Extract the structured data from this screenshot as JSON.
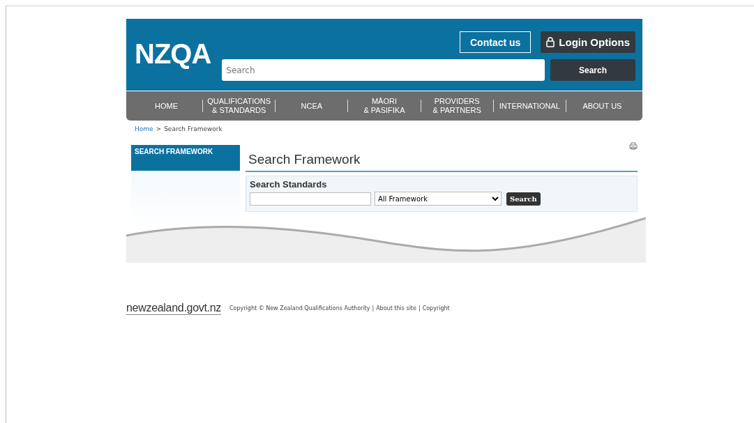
{
  "header": {
    "logo": "NZQA",
    "contact_button": "Contact us",
    "login_button": "Login Options",
    "search": {
      "placeholder": "Search"
    },
    "search_button": "Search"
  },
  "nav": [
    {
      "lines": [
        "HOME"
      ]
    },
    {
      "lines": [
        "QUALIFICATIONS",
        "& STANDARDS"
      ]
    },
    {
      "lines": [
        "NCEA"
      ]
    },
    {
      "lines": [
        "MĀORI",
        "& PASIFIKA"
      ]
    },
    {
      "lines": [
        "PROVIDERS",
        "& PARTNERS"
      ]
    },
    {
      "lines": [
        "INTERNATIONAL"
      ]
    },
    {
      "lines": [
        "ABOUT US"
      ]
    }
  ],
  "breadcrumb": {
    "separator": ">",
    "items": [
      {
        "label": "Home",
        "link": true
      },
      {
        "label": "Search Framework",
        "link": false
      }
    ]
  },
  "sidebar": {
    "title": "SEARCH FRAMEWORK"
  },
  "main": {
    "title": "Search Framework",
    "form": {
      "title": "Search Standards",
      "select": "All Framework",
      "button": "Search"
    }
  },
  "footer": {
    "logo": "newzealand.govt.nz",
    "copyright": "Copyright © New Zealand Qualifications Authority",
    "separator": "|",
    "links": [
      "About this site",
      "Copyright"
    ]
  }
}
